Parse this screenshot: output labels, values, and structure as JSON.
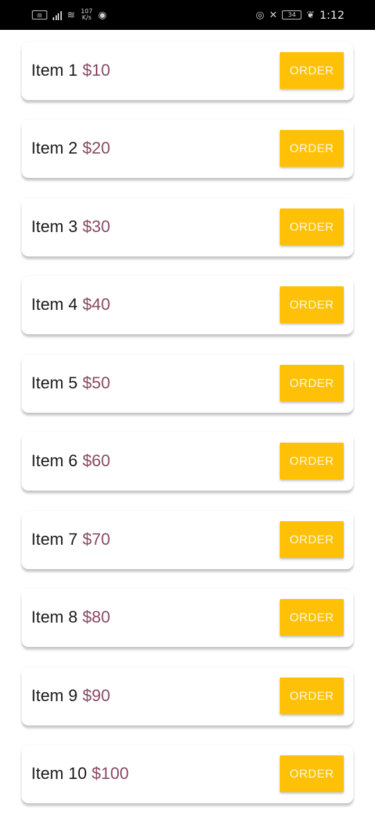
{
  "status_bar": {
    "network_speed_value": "107",
    "network_speed_unit": "K/s",
    "battery_level": "34",
    "time": "1:12",
    "icons": [
      "sim-card-icon",
      "signal-icon",
      "wifi-icon",
      "spotify-icon",
      "eye-comfort-icon",
      "mute-icon",
      "battery-icon",
      "leaf-icon"
    ]
  },
  "items": [
    {
      "name": "Item 1",
      "price": "$10",
      "button_label": "ORDER"
    },
    {
      "name": "Item 2",
      "price": "$20",
      "button_label": "ORDER"
    },
    {
      "name": "Item 3",
      "price": "$30",
      "button_label": "ORDER"
    },
    {
      "name": "Item 4",
      "price": "$40",
      "button_label": "ORDER"
    },
    {
      "name": "Item 5",
      "price": "$50",
      "button_label": "ORDER"
    },
    {
      "name": "Item 6",
      "price": "$60",
      "button_label": "ORDER"
    },
    {
      "name": "Item 7",
      "price": "$70",
      "button_label": "ORDER"
    },
    {
      "name": "Item 8",
      "price": "$80",
      "button_label": "ORDER"
    },
    {
      "name": "Item 9",
      "price": "$90",
      "button_label": "ORDER"
    },
    {
      "name": "Item 10",
      "price": "$100",
      "button_label": "ORDER"
    }
  ],
  "colors": {
    "status_bar_background": "#000000",
    "button_background": "#ffc107",
    "price_color": "#8a4a63",
    "item_text_color": "#1a1a1a"
  }
}
